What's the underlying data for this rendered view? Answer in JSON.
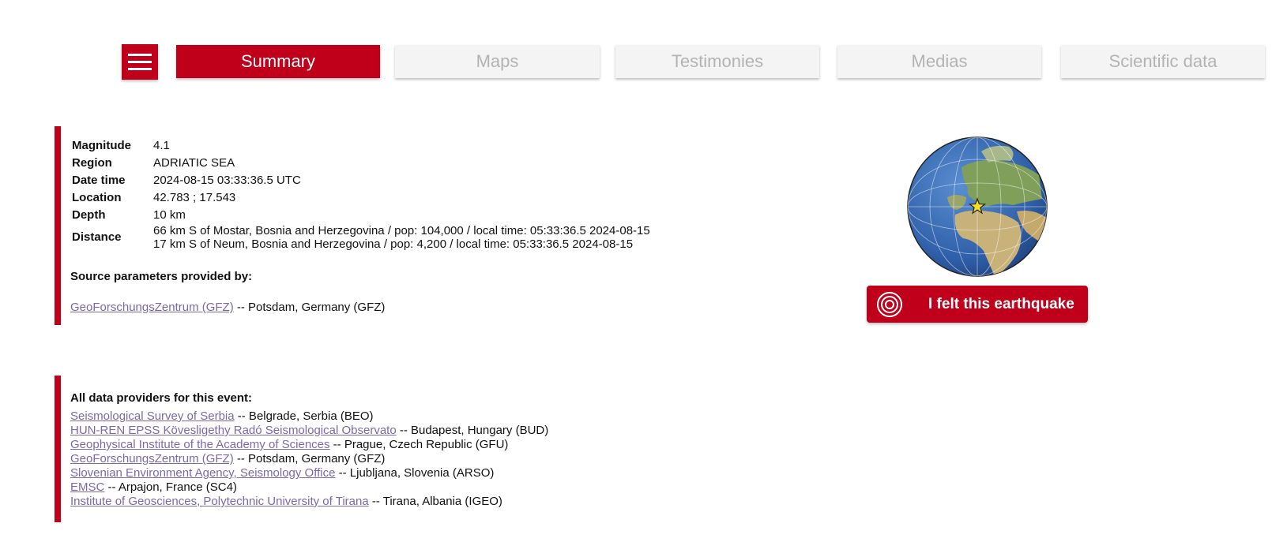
{
  "nav": {
    "tabs": [
      {
        "label": "Summary",
        "active": true
      },
      {
        "label": "Maps",
        "active": false
      },
      {
        "label": "Testimonies",
        "active": false
      },
      {
        "label": "Medias",
        "active": false
      },
      {
        "label": "Scientific data",
        "active": false
      }
    ],
    "menu_icon": "hamburger-icon"
  },
  "summary": {
    "rows": [
      {
        "label": "Magnitude",
        "value": "4.1"
      },
      {
        "label": "Region",
        "value": "ADRIATIC SEA"
      },
      {
        "label": "Date time",
        "value": "2024-08-15 03:33:36.5 UTC"
      },
      {
        "label": "Location",
        "value": "42.783 ; 17.543"
      },
      {
        "label": "Depth",
        "value": "10 km"
      }
    ],
    "distance_label": "Distance",
    "distance_lines": [
      "66 km S of Mostar, Bosnia and Herzegovina / pop: 104,000 / local time: 05:33:36.5 2024-08-15",
      "17 km S of Neum, Bosnia and Herzegovina / pop: 4,200 / local time: 05:33:36.5 2024-08-15"
    ],
    "source_title": "Source parameters provided by:",
    "source": {
      "link": "GeoForschungsZentrum (GFZ)",
      "rest": " -- Potsdam, Germany (GFZ)"
    }
  },
  "providers": {
    "title": "All data providers for this event:",
    "items": [
      {
        "link": "Seismological Survey of Serbia",
        "rest": " -- Belgrade, Serbia (BEO)"
      },
      {
        "link": "HUN-REN EPSS Kövesligethy Radó Seismological Observato",
        "rest": " -- Budapest, Hungary (BUD)"
      },
      {
        "link": "Geophysical Institute of the Academy of Sciences",
        "rest": " -- Prague, Czech Republic (GFU)"
      },
      {
        "link": "GeoForschungsZentrum (GFZ)",
        "rest": " -- Potsdam, Germany (GFZ)"
      },
      {
        "link": "Slovenian Environment Agency, Seismology Office",
        "rest": " -- Ljubljana, Slovenia (ARSO)"
      },
      {
        "link": "EMSC",
        "rest": " -- Arpajon, France (SC4)"
      },
      {
        "link": "Institute of Geosciences, Polytechnic University of Tirana",
        "rest": " -- Tirana, Albania (IGEO)"
      }
    ]
  },
  "felt_button": {
    "label": "I felt this earthquake",
    "icon": "felt-rings-icon"
  },
  "globe": {
    "icon": "globe-icon",
    "marker": "epicenter-star-icon"
  },
  "colors": {
    "accent": "#c0001a",
    "link": "#7a6aa8",
    "tab_inactive_bg": "#f4f4f4",
    "tab_inactive_text": "#b3b3b3"
  }
}
